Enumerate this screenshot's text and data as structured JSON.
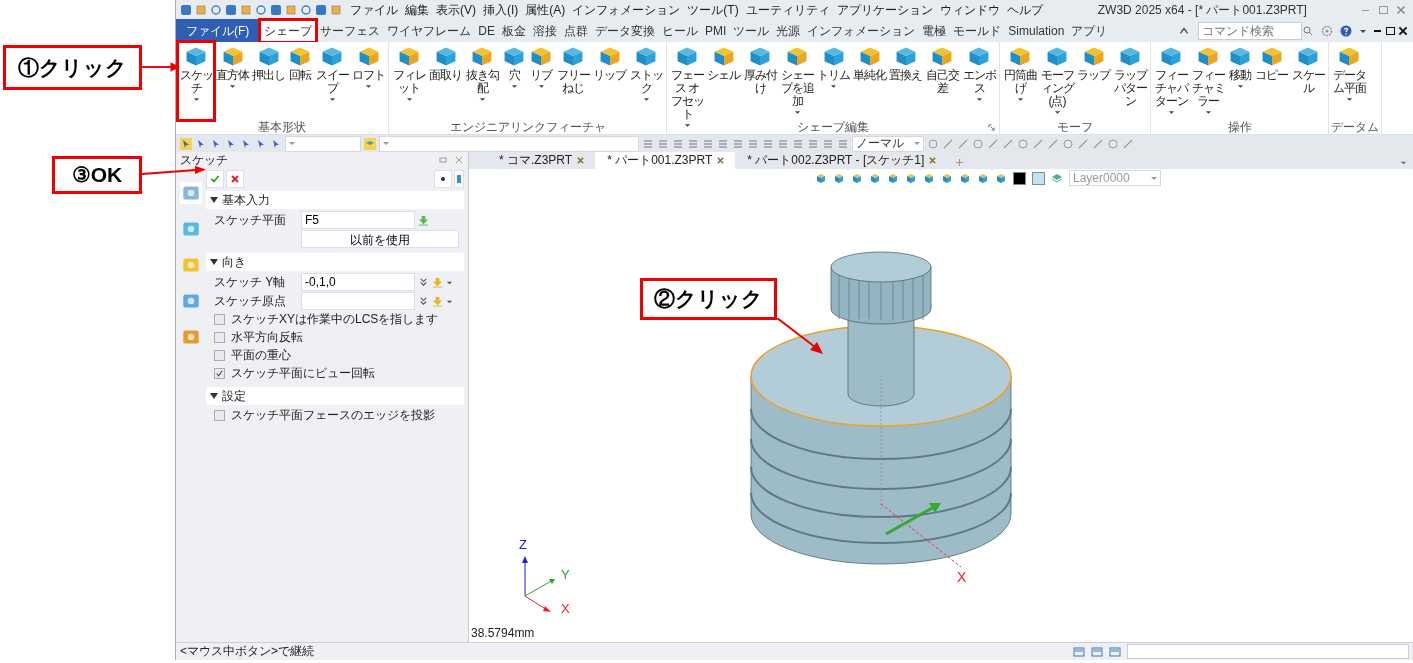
{
  "window": {
    "title": "ZW3D 2025 x64 - [* パート001.Z3PRT]"
  },
  "menu": [
    "ファイル",
    "編集",
    "表示(V)",
    "挿入(I)",
    "属性(A)",
    "インフォメーション",
    "ツール(T)",
    "ユーティリティ",
    "アプリケーション",
    "ウィンドウ",
    "ヘルプ"
  ],
  "ribbon_tabs": [
    {
      "label": "ファイル(F)",
      "kind": "file",
      "selected": false
    },
    {
      "label": "シェープ",
      "kind": "tab",
      "selected": true,
      "callout_frame": true
    },
    {
      "label": "サーフェス",
      "kind": "tab",
      "selected": false
    },
    {
      "label": "ワイヤフレーム",
      "kind": "tab",
      "selected": false
    },
    {
      "label": "DE",
      "kind": "tab",
      "selected": false
    },
    {
      "label": "板金",
      "kind": "tab",
      "selected": false
    },
    {
      "label": "溶接",
      "kind": "tab",
      "selected": false
    },
    {
      "label": "点群",
      "kind": "tab",
      "selected": false
    },
    {
      "label": "データ変換",
      "kind": "tab",
      "selected": false
    },
    {
      "label": "ヒール",
      "kind": "tab",
      "selected": false
    },
    {
      "label": "PMI",
      "kind": "tab",
      "selected": false
    },
    {
      "label": "ツール",
      "kind": "tab",
      "selected": false
    },
    {
      "label": "光源",
      "kind": "tab",
      "selected": false
    },
    {
      "label": "インフォメーション",
      "kind": "tab",
      "selected": false
    },
    {
      "label": "電極",
      "kind": "tab",
      "selected": false
    },
    {
      "label": "モールド",
      "kind": "tab",
      "selected": false
    },
    {
      "label": "Simulation",
      "kind": "tab",
      "selected": false
    },
    {
      "label": "アプリ",
      "kind": "tab",
      "selected": false
    }
  ],
  "command_search": {
    "placeholder": "コマンド検索"
  },
  "ribbon_groups": [
    {
      "label": "基本形状",
      "buttons": [
        {
          "label": "スケッチ",
          "dropdown": true,
          "callout_frame": true
        },
        {
          "label": "直方体",
          "dropdown": true
        },
        {
          "label": "押出し",
          "dropdown": false
        },
        {
          "label": "回転",
          "dropdown": false
        },
        {
          "label": "スイープ",
          "dropdown": true
        },
        {
          "label": "ロフト",
          "dropdown": true
        }
      ]
    },
    {
      "label": "エンジニアリンクフィーチャ",
      "buttons": [
        {
          "label": "フィレット",
          "dropdown": true
        },
        {
          "label": "面取り",
          "dropdown": false
        },
        {
          "label": "抜き勾配",
          "dropdown": true
        },
        {
          "label": "穴",
          "dropdown": true
        },
        {
          "label": "リブ",
          "dropdown": true
        },
        {
          "label": "フリーねじ",
          "dropdown": false
        },
        {
          "label": "リップ",
          "dropdown": false
        },
        {
          "label": "ストック",
          "dropdown": true
        }
      ]
    },
    {
      "label": "シェープ編集",
      "launcher": true,
      "buttons": [
        {
          "label": "フェース オフセット",
          "dropdown": true
        },
        {
          "label": "シェル",
          "dropdown": false
        },
        {
          "label": "厚み付け",
          "dropdown": false
        },
        {
          "label": "シェープを追加",
          "dropdown": true
        },
        {
          "label": "トリム",
          "dropdown": true
        },
        {
          "label": "単純化",
          "dropdown": false
        },
        {
          "label": "置換え",
          "dropdown": false
        },
        {
          "label": "自己交差",
          "dropdown": false
        },
        {
          "label": "エンボス",
          "dropdown": true
        }
      ]
    },
    {
      "label": "モーフ",
      "buttons": [
        {
          "label": "円筒曲げ",
          "dropdown": true
        },
        {
          "label": "モーフィング(点)",
          "dropdown": true
        },
        {
          "label": "ラップ",
          "dropdown": false
        },
        {
          "label": "ラップパターン",
          "dropdown": false
        }
      ]
    },
    {
      "label": "操作",
      "buttons": [
        {
          "label": "フィーチャパターン",
          "dropdown": true
        },
        {
          "label": "フィーチャミラー",
          "dropdown": true
        },
        {
          "label": "移動",
          "dropdown": true
        },
        {
          "label": "コピー",
          "dropdown": false
        },
        {
          "label": "スケール",
          "dropdown": false
        }
      ]
    },
    {
      "label": "データム",
      "buttons": [
        {
          "label": "データム平面",
          "dropdown": true
        }
      ]
    }
  ],
  "toolbar": {
    "filter": "ノーマル"
  },
  "panel": {
    "title": "スケッチ",
    "sections": [
      {
        "title": "基本入力",
        "expanded": true,
        "rows": [
          {
            "kind": "field",
            "label": "スケッチ平面",
            "value": "F5"
          },
          {
            "kind": "button",
            "label": "以前を使用"
          }
        ]
      },
      {
        "title": "向き",
        "expanded": true,
        "rows": [
          {
            "kind": "vector",
            "label": "スケッチ Y軸",
            "value": "-0,1,0"
          },
          {
            "kind": "vector",
            "label": "スケッチ原点"
          },
          {
            "kind": "checkbox",
            "label": "スケッチXYは作業中のLCSを指します",
            "checked": false
          },
          {
            "kind": "checkbox",
            "label": "水平方向反転",
            "checked": false
          },
          {
            "kind": "checkbox",
            "label": "平面の重心",
            "checked": false
          },
          {
            "kind": "checkbox",
            "label": "スケッチ平面にビュー回転",
            "checked": true
          }
        ]
      },
      {
        "title": "設定",
        "expanded": true,
        "rows": [
          {
            "kind": "checkbox",
            "label": "スケッチ平面フェースのエッジを投影",
            "checked": false
          }
        ]
      }
    ]
  },
  "doc_tabs": [
    {
      "label": "* コマ.Z3PRT",
      "selected": false
    },
    {
      "label": "* パート001.Z3PRT",
      "selected": true
    },
    {
      "label": "* パート002.Z3PRT - [スケッチ1]",
      "selected": false
    }
  ],
  "layer": {
    "value": "Layer0000",
    "disabled": true
  },
  "viewport": {
    "model_axis": "X",
    "triad": [
      "Z",
      "Y",
      "X"
    ],
    "readout": "38.5794mm"
  },
  "status_bar": {
    "hint": "<マウス中ボタン>で継続"
  },
  "annotations": [
    {
      "label": "①クリック"
    },
    {
      "label": "③OK"
    },
    {
      "label": "②クリック"
    }
  ]
}
